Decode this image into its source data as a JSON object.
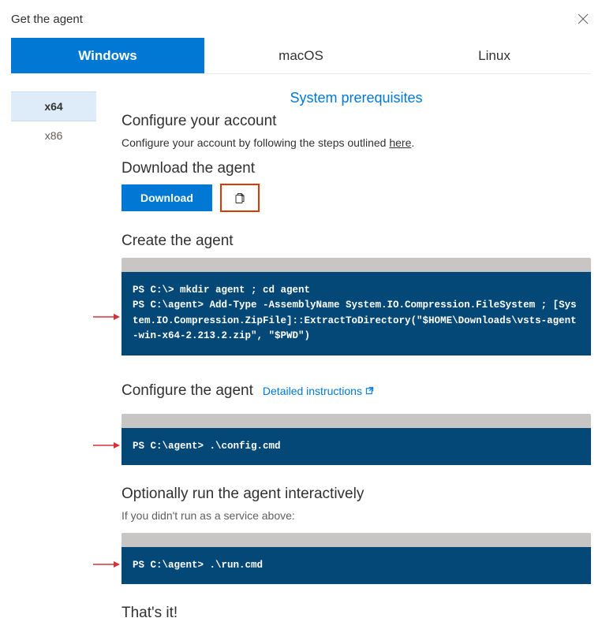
{
  "title": "Get the agent",
  "tabs": {
    "windows": "Windows",
    "macos": "macOS",
    "linux": "Linux"
  },
  "arch": {
    "x64": "x64",
    "x86": "x86"
  },
  "prereq": "System prerequisites",
  "configure_account": {
    "heading": "Configure your account",
    "text_prefix": "Configure your account by following the steps outlined ",
    "link": "here",
    "text_suffix": "."
  },
  "download": {
    "heading": "Download the agent",
    "button": "Download"
  },
  "create": {
    "heading": "Create the agent",
    "code": "PS C:\\> mkdir agent ; cd agent\nPS C:\\agent> Add-Type -AssemblyName System.IO.Compression.FileSystem ; [System.IO.Compression.ZipFile]::ExtractToDirectory(\"$HOME\\Downloads\\vsts-agent-win-x64-2.213.2.zip\", \"$PWD\")"
  },
  "configure_agent": {
    "heading": "Configure the agent",
    "link": "Detailed instructions",
    "code": "PS C:\\agent> .\\config.cmd"
  },
  "run": {
    "heading": "Optionally run the agent interactively",
    "subtext": "If you didn't run as a service above:",
    "code": "PS C:\\agent> .\\run.cmd"
  },
  "done": "That's it!"
}
